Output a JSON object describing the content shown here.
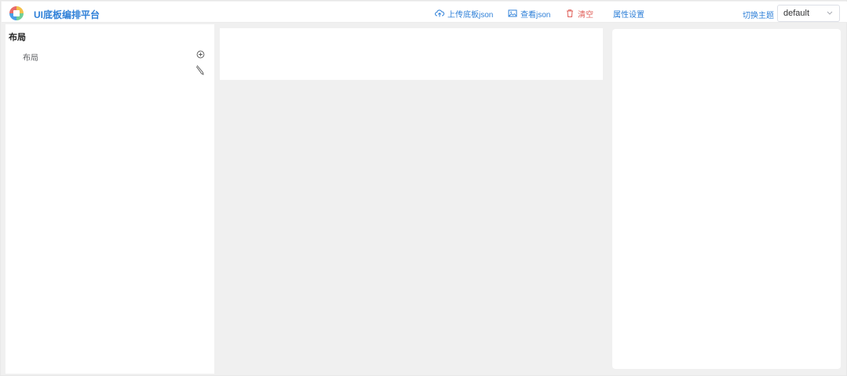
{
  "header": {
    "title": "UI底板编排平台",
    "toolbar": {
      "upload_label": "上传底板json",
      "view_label": "查看json",
      "clear_label": "清空",
      "props_label": "属性设置"
    },
    "theme_label": "切换主题",
    "theme_value": "default"
  },
  "sidebar": {
    "title": "布局",
    "tree": [
      {
        "label": "布局"
      }
    ]
  },
  "colors": {
    "accent": "#2f80d8",
    "danger": "#e0605a",
    "workspace_bg": "#f0f0f0"
  },
  "icons": {
    "logo": "app-logo",
    "upload": "cloud-upload-icon",
    "view": "picture-icon",
    "clear": "trash-icon",
    "theme_select": "chevron-down-icon",
    "tree_add": "plus-circle-icon",
    "tree_edit": "pencil-icon"
  }
}
